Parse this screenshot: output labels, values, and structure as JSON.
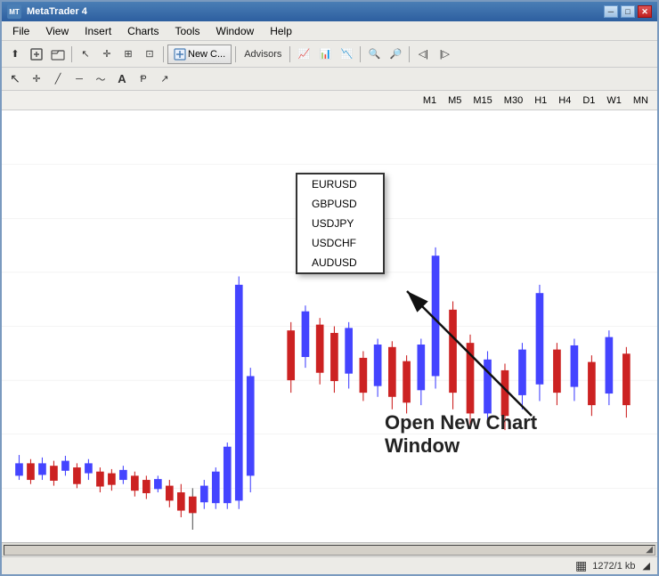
{
  "window": {
    "title": "MetaTrader 4",
    "title_buttons": {
      "minimize": "─",
      "maximize": "□",
      "close": "✕"
    }
  },
  "menu": {
    "items": [
      "File",
      "View",
      "Insert",
      "Charts",
      "Tools",
      "Window",
      "Help"
    ]
  },
  "toolbar": {
    "new_label": "New C...",
    "timeframes": [
      "M1",
      "M5",
      "M15",
      "M30",
      "H1",
      "H4",
      "D1",
      "W1",
      "MN"
    ]
  },
  "dropdown": {
    "items": [
      "EURUSD",
      "GBPUSD",
      "USDJPY",
      "USDCHF",
      "AUDUSD"
    ]
  },
  "annotation": {
    "text_line1": "Open New Chart",
    "text_line2": "Window"
  },
  "status_bar": {
    "right_text": "1272/1 kb",
    "scroll_icon": "▦"
  }
}
